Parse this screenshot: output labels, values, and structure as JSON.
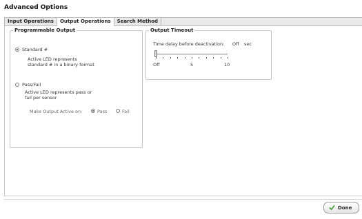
{
  "window": {
    "title": "Advanced Options"
  },
  "tabs": [
    {
      "label": "Input Operations"
    },
    {
      "label": "Output Operations"
    },
    {
      "label": "Search Method"
    }
  ],
  "programmable_output": {
    "legend": "Programmable Output",
    "standard": {
      "label": "Standard #",
      "desc_line1": "Active LED represents",
      "desc_line2": "standard # in a binary format",
      "checked": true
    },
    "passfail": {
      "label": "Pass/Fail",
      "desc_line1": "Active LED represents pass or",
      "desc_line2": "fail per sensor",
      "checked": false
    },
    "make_active": {
      "label": "Make Output Active on:",
      "pass_label": "Pass",
      "fail_label": "Fail",
      "selected": "Pass"
    }
  },
  "output_timeout": {
    "legend": "Output Timeout",
    "delay_label": "Time delay before deactivation:",
    "value": "Off",
    "unit": "sec",
    "slider": {
      "min_label": "Off",
      "mid_label": "5",
      "max_label": "10",
      "level": 0
    }
  },
  "footer": {
    "done_label": "Done"
  },
  "icons": {
    "done_icon": "checkmark-icon"
  },
  "colors": {
    "check_green": "#3a9a2a"
  }
}
